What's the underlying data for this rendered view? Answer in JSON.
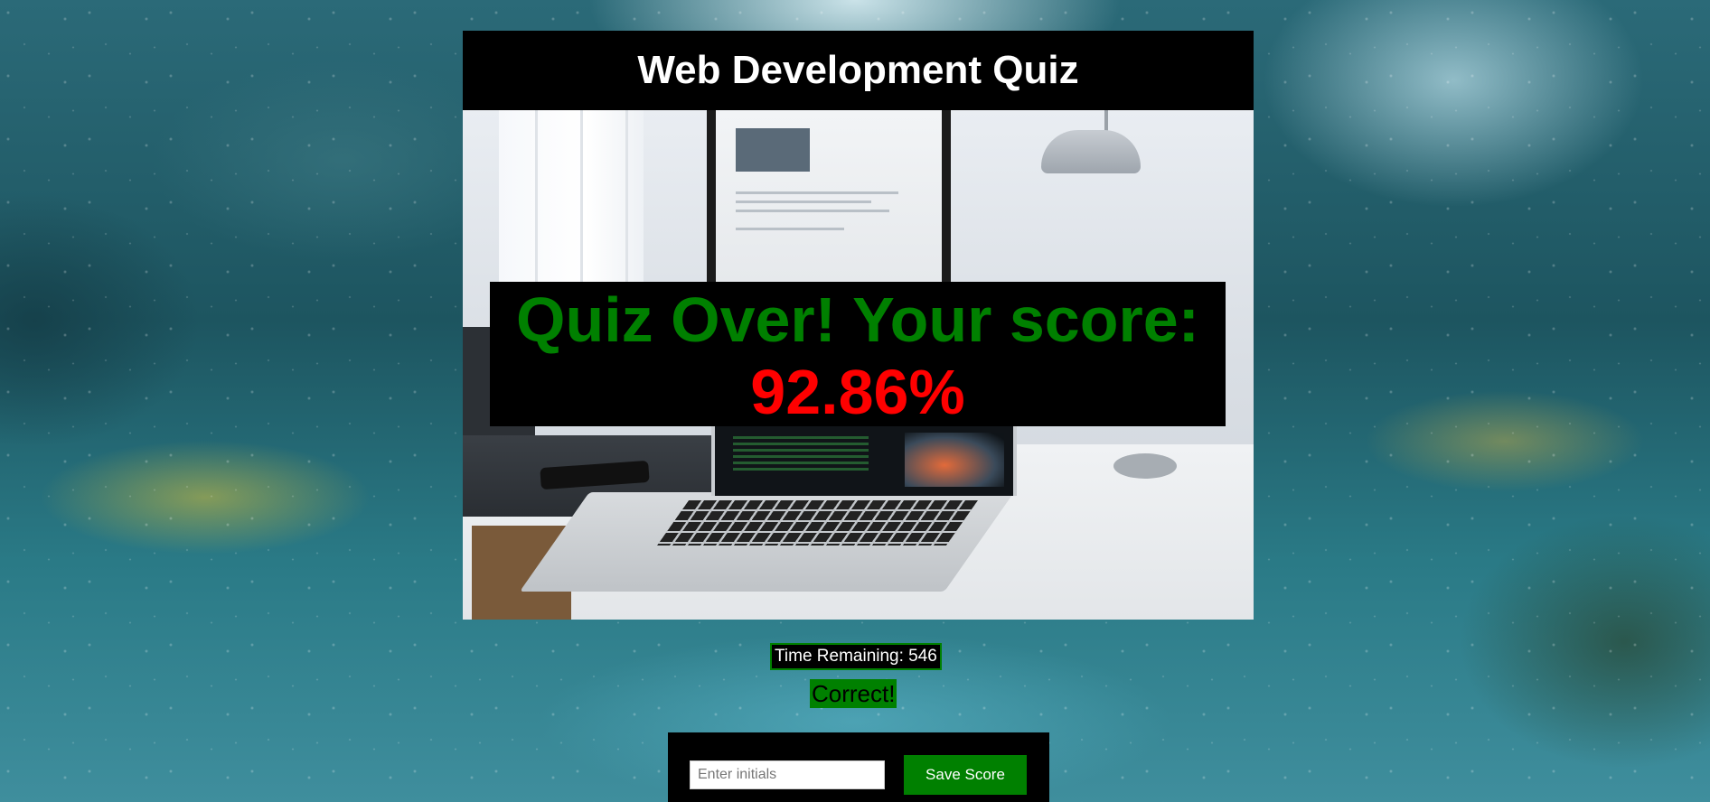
{
  "header": {
    "title": "Web Development Quiz"
  },
  "hero": {
    "image": "desk-laptop-photo"
  },
  "result": {
    "label": "Quiz Over! Your score:",
    "score": "92.86%"
  },
  "timer": {
    "text": "Time Remaining: 546"
  },
  "feedback": {
    "text": "Correct!"
  },
  "save": {
    "placeholder": "Enter initials",
    "value": "",
    "button_label": "Save Score"
  },
  "colors": {
    "accent_green": "#008000",
    "score_red": "#ff0000",
    "panel_black": "#000000"
  }
}
